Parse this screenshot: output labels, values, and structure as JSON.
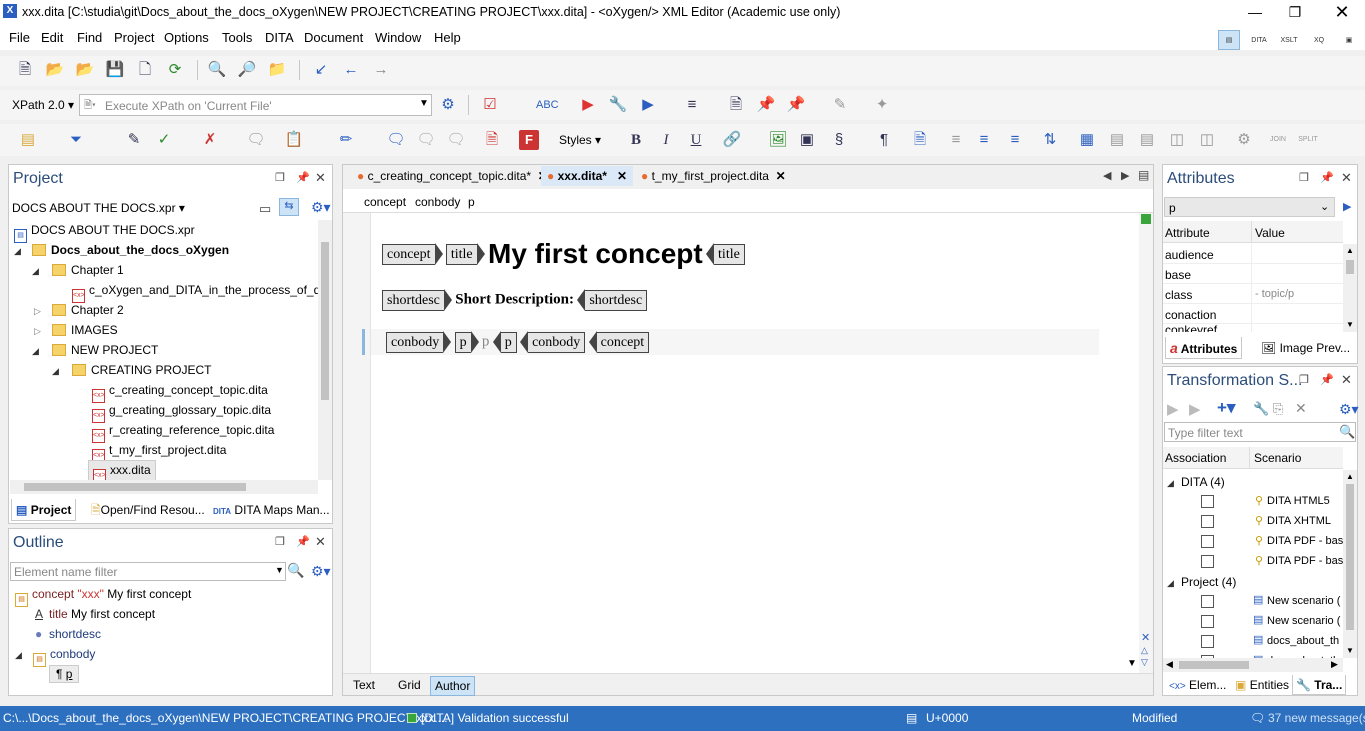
{
  "window": {
    "title": "xxx.dita [C:\\studia\\git\\Docs_about_the_docs_oXygen\\NEW PROJECT\\CREATING PROJECT\\xxx.dita] - <oXygen/> XML Editor (Academic use only)"
  },
  "menus": [
    "File",
    "Edit",
    "Find",
    "Project",
    "Options",
    "Tools",
    "DITA",
    "Document",
    "Window",
    "Help"
  ],
  "xpath": {
    "version": "XPath 2.0",
    "placeholder": "Execute XPath on  'Current File'"
  },
  "format_toolbar": {
    "styles_label": "Styles"
  },
  "project_panel": {
    "title": "Project",
    "selector": "DOCS ABOUT THE DOCS.xpr",
    "tree": [
      {
        "label": "DOCS ABOUT THE DOCS.xpr"
      },
      {
        "label": "Docs_about_the_docs_oXygen"
      },
      {
        "label": "Chapter 1"
      },
      {
        "label": "c_oXygen_and_DITA_in_the_process_of_docu"
      },
      {
        "label": "Chapter 2"
      },
      {
        "label": "IMAGES"
      },
      {
        "label": "NEW PROJECT"
      },
      {
        "label": "CREATING PROJECT"
      },
      {
        "label": "c_creating_concept_topic.dita"
      },
      {
        "label": "g_creating_glossary_topic.dita"
      },
      {
        "label": "r_creating_reference_topic.dita"
      },
      {
        "label": "t_my_first_project.dita"
      },
      {
        "label": "xxx.dita"
      }
    ],
    "tabs": [
      "Project",
      "Open/Find Resou...",
      "DITA Maps Man..."
    ]
  },
  "outline_panel": {
    "title": "Outline",
    "filter_placeholder": "Element name filter",
    "nodes": [
      {
        "name": "concept",
        "id": "\"xxx\"",
        "text": "My first concept"
      },
      {
        "name": "title",
        "text": "My first concept"
      },
      {
        "name": "shortdesc"
      },
      {
        "name": "conbody"
      },
      {
        "name": "p"
      }
    ]
  },
  "editor": {
    "tabs": [
      "c_creating_concept_topic.dita*",
      "xxx.dita*",
      "t_my_first_project.dita"
    ],
    "breadcrumb": [
      "concept",
      "conbody",
      "p"
    ],
    "content": {
      "concept_tag": "concept",
      "title_tag": "title",
      "title_text": "My first concept",
      "shortdesc_tag": "shortdesc",
      "shortdesc_text": "Short Description:",
      "conbody_tag": "conbody",
      "p_tag": "p",
      "p_placeholder": "p"
    },
    "modes": [
      "Text",
      "Grid",
      "Author"
    ]
  },
  "attributes_panel": {
    "title": "Attributes",
    "element": "p",
    "headers": [
      "Attribute",
      "Value"
    ],
    "rows": [
      {
        "attr": "audience",
        "value": ""
      },
      {
        "attr": "base",
        "value": ""
      },
      {
        "attr": "class",
        "value": "- topic/p"
      },
      {
        "attr": "conaction",
        "value": ""
      },
      {
        "attr": "conkeyref",
        "value": ""
      }
    ],
    "tabs": [
      "Attributes",
      "Image Prev..."
    ]
  },
  "transformation_panel": {
    "title": "Transformation S...",
    "filter_placeholder": "Type filter text",
    "headers": [
      "Association",
      "Scenario"
    ],
    "groups": [
      {
        "label": "DITA (4)",
        "items": [
          "DITA HTML5",
          "DITA XHTML",
          "DITA PDF - bas",
          "DITA PDF - bas"
        ]
      },
      {
        "label": "Project (4)",
        "items": [
          "New scenario (",
          "New scenario (",
          "docs_about_th",
          "docs_about_th"
        ]
      }
    ],
    "tabs": [
      "Elem...",
      "Entities",
      "Tra..."
    ]
  },
  "status_bar": {
    "path": "C:\\...\\Docs_about_the_docs_oXygen\\NEW PROJECT\\CREATING PROJECT\\xxx....",
    "validation": "[DITA] Validation successful",
    "unicode": "U+0000",
    "modified": "Modified",
    "messages": "37 new message(s)"
  },
  "colors": {
    "statusbar": "#2d70c0",
    "title_accent": "#2b4d7a",
    "active_mode": "#cde4f7"
  }
}
